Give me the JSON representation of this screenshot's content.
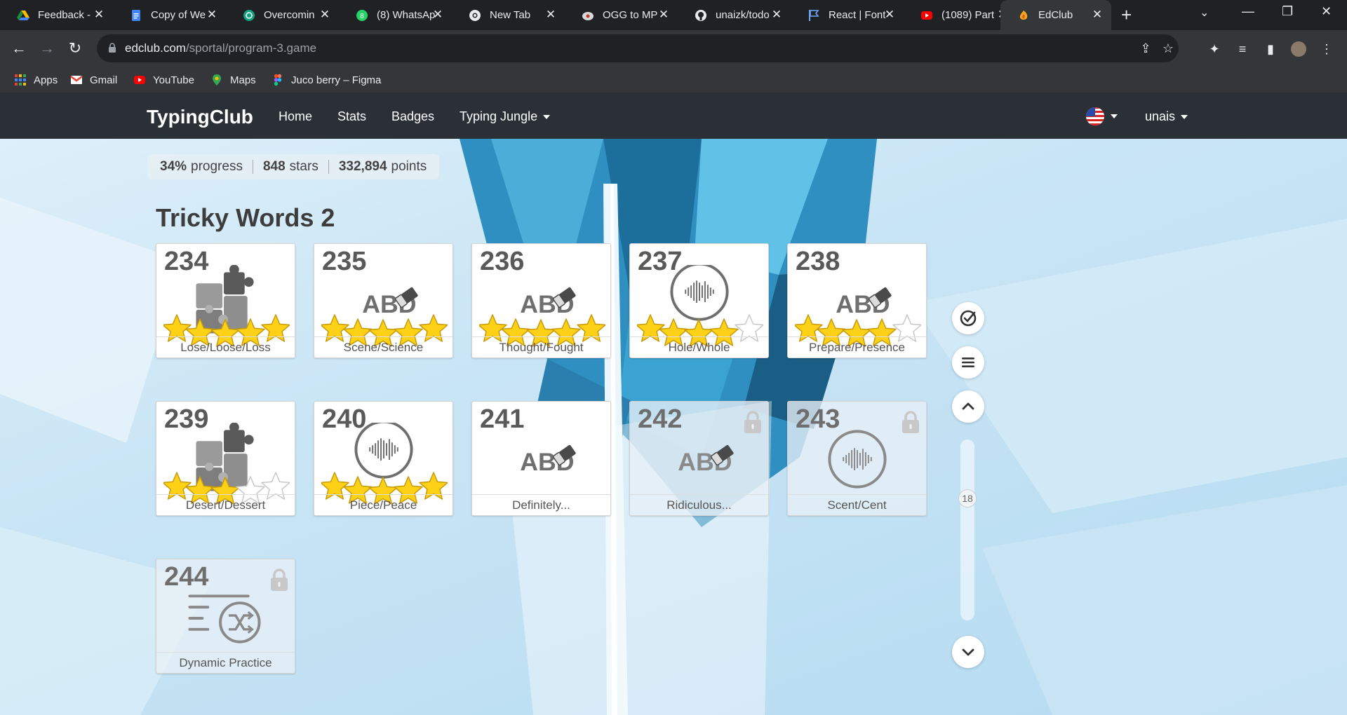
{
  "browser": {
    "tabs": [
      {
        "title": "Feedback -",
        "icon": "drive-icon"
      },
      {
        "title": "Copy of We",
        "icon": "docs-icon"
      },
      {
        "title": "Overcomin",
        "icon": "chatgpt-icon"
      },
      {
        "title": "(8) WhatsAp",
        "icon": "whatsapp-icon"
      },
      {
        "title": "New Tab",
        "icon": "chrome-icon"
      },
      {
        "title": "OGG to MP",
        "icon": "converter-icon"
      },
      {
        "title": "unaizk/todo",
        "icon": "github-icon"
      },
      {
        "title": "React | Font",
        "icon": "flag-icon"
      },
      {
        "title": "(1089) Part",
        "icon": "youtube-icon"
      },
      {
        "title": "EdClub",
        "icon": "edclub-icon"
      }
    ],
    "url_host": "edclub.com",
    "url_path": "/sportal/program-3.game",
    "bookmarks": [
      {
        "label": "Apps",
        "icon": "apps-grid-icon"
      },
      {
        "label": "Gmail",
        "icon": "gmail-icon"
      },
      {
        "label": "YouTube",
        "icon": "youtube-icon"
      },
      {
        "label": "Maps",
        "icon": "maps-icon"
      },
      {
        "label": "Juco berry – Figma",
        "icon": "figma-icon"
      }
    ]
  },
  "app": {
    "brand": "TypingClub",
    "nav": [
      "Home",
      "Stats",
      "Badges",
      "Typing Jungle"
    ],
    "user": "unais",
    "language_flag": "us-flag-icon"
  },
  "stats": {
    "progress_value": "34%",
    "progress_label": "progress",
    "stars_value": "848",
    "stars_label": "stars",
    "points_value": "332,894",
    "points_label": "points"
  },
  "section_title": "Tricky Words 2",
  "lessons": [
    {
      "number": "234",
      "label": "Lose/Loose/Loss",
      "type": "puzzle",
      "stars": 5,
      "locked": false
    },
    {
      "number": "235",
      "label": "Scene/Science",
      "type": "abc",
      "stars": 5,
      "locked": false
    },
    {
      "number": "236",
      "label": "Thought/Fought",
      "type": "abc",
      "stars": 5,
      "locked": false
    },
    {
      "number": "237",
      "label": "Hole/Whole",
      "type": "audio",
      "stars": 4,
      "locked": false
    },
    {
      "number": "238",
      "label": "Prepare/Presence",
      "type": "abc",
      "stars": 4,
      "locked": false
    },
    {
      "number": "239",
      "label": "Desert/Dessert",
      "type": "puzzle",
      "stars": 3,
      "locked": false
    },
    {
      "number": "240",
      "label": "Piece/Peace",
      "type": "audio",
      "stars": 5,
      "locked": false
    },
    {
      "number": "241",
      "label": "Definitely...",
      "type": "abc",
      "stars": 0,
      "locked": false
    },
    {
      "number": "242",
      "label": "Ridiculous...",
      "type": "abc",
      "stars": 0,
      "locked": true
    },
    {
      "number": "243",
      "label": "Scent/Cent",
      "type": "audio",
      "stars": 0,
      "locked": true
    },
    {
      "number": "244",
      "label": "Dynamic Practice",
      "type": "shuffle",
      "stars": 0,
      "locked": true
    }
  ],
  "abc_text": "ABD",
  "scroll_position": "18"
}
